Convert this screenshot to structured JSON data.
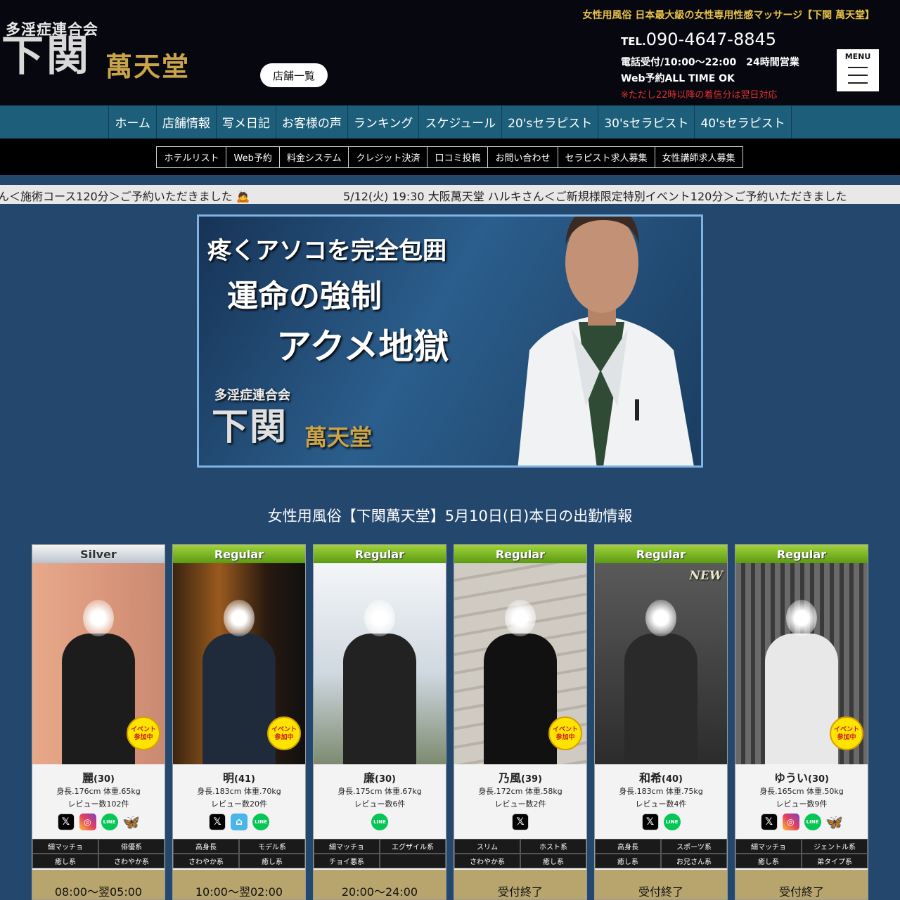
{
  "header": {
    "logo_sub": "多淫症連合会",
    "logo_main": "下関",
    "logo_gold": "萬天堂",
    "store_list_label": "店舗一覧",
    "tagline": "女性用風俗 日本最大級の女性専用性感マッサージ【下関 萬天堂】",
    "tel_prefix": "TEL.",
    "tel_number": "090-4647-8845",
    "hours_line1": "電話受付/10:00～22:00　24時間営業",
    "hours_line2": "Web予約ALL TIME OK",
    "hours_note": "※ただし22時以降の着信分は翌日対応",
    "menu_label": "MENU"
  },
  "main_nav": [
    "ホーム",
    "店舗情報",
    "写メ日記",
    "お客様の声",
    "ランキング",
    "スケジュール",
    "20'sセラピスト",
    "30'sセラピスト",
    "40'sセラピスト"
  ],
  "sub_nav": [
    "ホテルリスト",
    "Web予約",
    "料金システム",
    "クレジット決済",
    "口コミ投稿",
    "お問い合わせ",
    "セラピスト求人募集",
    "女性講師求人募集"
  ],
  "ticker": {
    "left_text": "ん＜施術コース120分＞ご予約いただきました 🙇",
    "right_text": "5/12(火) 19:30 大阪萬天堂 ハルキさん＜ご新規様限定特別イベント120分＞ご予約いただきました"
  },
  "banner": {
    "line1": "疼くアソコを完全包囲",
    "line2": "運命の強制",
    "line3": "アクメ地獄",
    "sub": "多淫症連合会",
    "logo": "下関",
    "logo_gold": "萬天堂"
  },
  "today_heading": "女性用風俗【下関萬天堂】5月10日(日)本日の出勤情報",
  "event_badge": "イベント\n参加中",
  "new_badge": "NEW",
  "therapists": [
    {
      "rank": "Silver",
      "name": "麗",
      "age": "(30)",
      "body": "身長.176cm 体重.65kg",
      "reviews": "レビュー数102件",
      "sns": [
        "x",
        "instagram",
        "line",
        "bluesky"
      ],
      "tags": [
        "細マッチョ",
        "俳優系",
        "癒し系",
        "さわやか系"
      ],
      "time": "08:00～翌05:00",
      "event": true,
      "new": false
    },
    {
      "rank": "Regular",
      "name": "明",
      "age": "(41)",
      "body": "身長.183cm 体重.70kg",
      "reviews": "レビュー数20件",
      "sns": [
        "x",
        "homeline",
        "line"
      ],
      "tags": [
        "高身長",
        "モデル系",
        "さわやか系",
        "癒し系"
      ],
      "time": "10:00～翌02:00",
      "event": true,
      "new": false
    },
    {
      "rank": "Regular",
      "name": "廉",
      "age": "(30)",
      "body": "身長.175cm 体重.67kg",
      "reviews": "レビュー数6件",
      "sns": [
        "line"
      ],
      "tags": [
        "細マッチョ",
        "エグザイル系",
        "チョイ悪系",
        ""
      ],
      "time": "20:00～24:00",
      "event": false,
      "new": false
    },
    {
      "rank": "Regular",
      "name": "乃風",
      "age": "(39)",
      "body": "身長.172cm 体重.58kg",
      "reviews": "レビュー数2件",
      "sns": [
        "x"
      ],
      "tags": [
        "スリム",
        "ホスト系",
        "さわやか系",
        "癒し系"
      ],
      "time": "受付終了",
      "event": true,
      "new": false
    },
    {
      "rank": "Regular",
      "name": "和希",
      "age": "(40)",
      "body": "身長.183cm 体重.75kg",
      "reviews": "レビュー数4件",
      "sns": [
        "x",
        "line"
      ],
      "tags": [
        "高身長",
        "スポーツ系",
        "癒し系",
        "お兄さん系"
      ],
      "time": "受付終了",
      "event": false,
      "new": true
    },
    {
      "rank": "Regular",
      "name": "ゆうい",
      "age": "(30)",
      "body": "身長.165cm 体重.50kg",
      "reviews": "レビュー数9件",
      "sns": [
        "x",
        "instagram",
        "line",
        "bluesky"
      ],
      "tags": [
        "細マッチョ",
        "ジェントル系",
        "癒し系",
        "弟タイプ系"
      ],
      "time": "受付終了",
      "event": true,
      "new": false
    }
  ],
  "colors": {
    "page_bg": "#24476e",
    "header_bg": "#07080f",
    "main_nav_bg": "#1d5f7a",
    "accent_gold": "#c9a449",
    "tagline": "#e8c24a",
    "note_red": "#e53030",
    "time_bar": "#b8a46d"
  }
}
